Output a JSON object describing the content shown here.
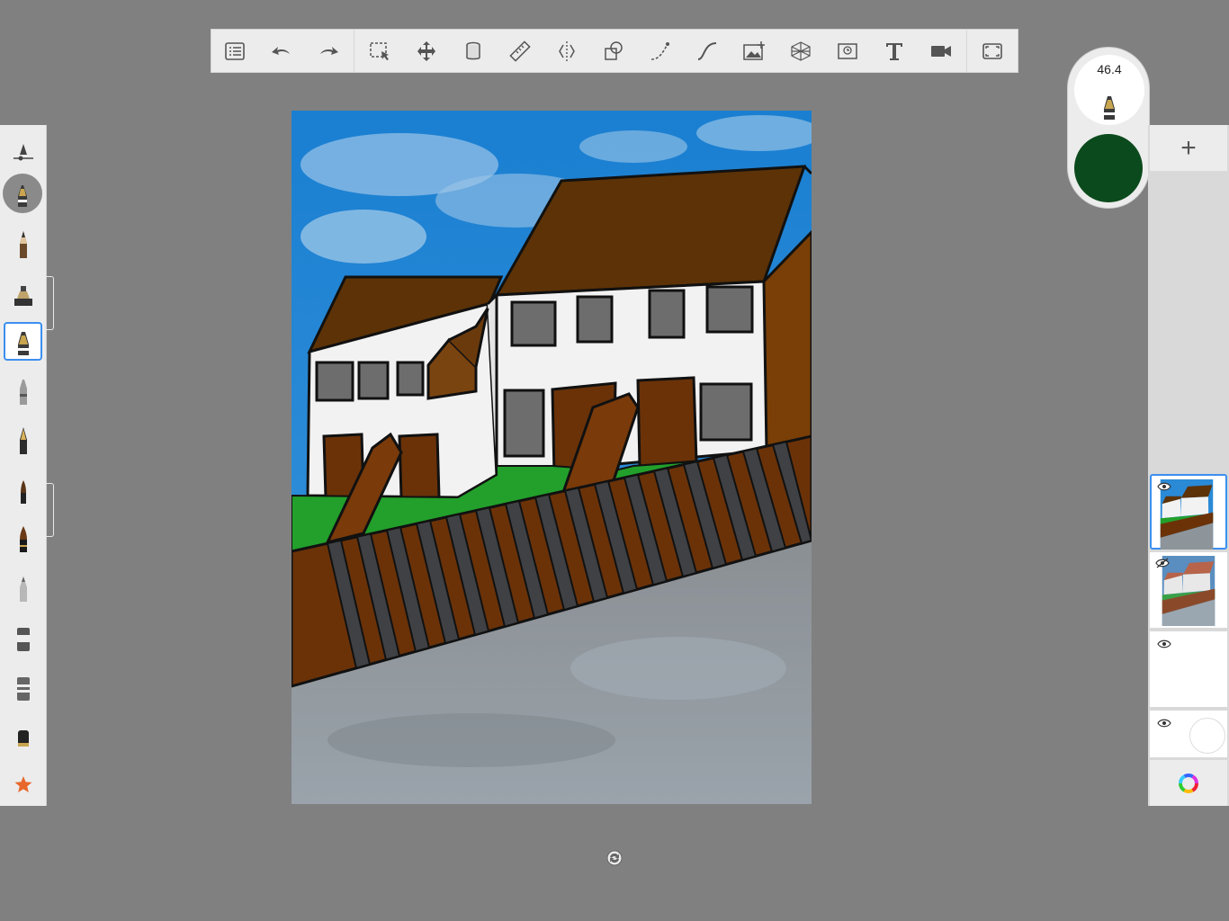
{
  "toolbar": {
    "tools": [
      "gallery",
      "undo",
      "redo",
      "selection",
      "transform",
      "fill",
      "ruler",
      "symmetry",
      "shapes",
      "stroke",
      "curve",
      "import-image",
      "perspective",
      "time-lapse",
      "text",
      "record",
      "fullscreen"
    ]
  },
  "brush_library": {
    "brushes": [
      "brush-properties",
      "current-brush",
      "pencil",
      "marker",
      "airbrush-selected",
      "technical-pen",
      "fountain-pen",
      "paintbrush",
      "ink-brush",
      "soft-pencil",
      "blender",
      "smudge",
      "eraser",
      "favorites"
    ]
  },
  "puck": {
    "brush_size": "46.4",
    "color": "#0b4a1c"
  },
  "layers": {
    "add_label": "+",
    "items": [
      {
        "name": "layer-1",
        "selected": true,
        "visible": true
      },
      {
        "name": "layer-2",
        "selected": false,
        "visible": false
      },
      {
        "name": "layer-3",
        "selected": false,
        "visible": true
      },
      {
        "name": "background-layer",
        "selected": false,
        "visible": true
      }
    ]
  },
  "colors": {
    "accent": "#3b8ff0",
    "current_color": "#0b4a1c",
    "toolbar_bg": "#ececec",
    "app_bg": "#808080"
  }
}
